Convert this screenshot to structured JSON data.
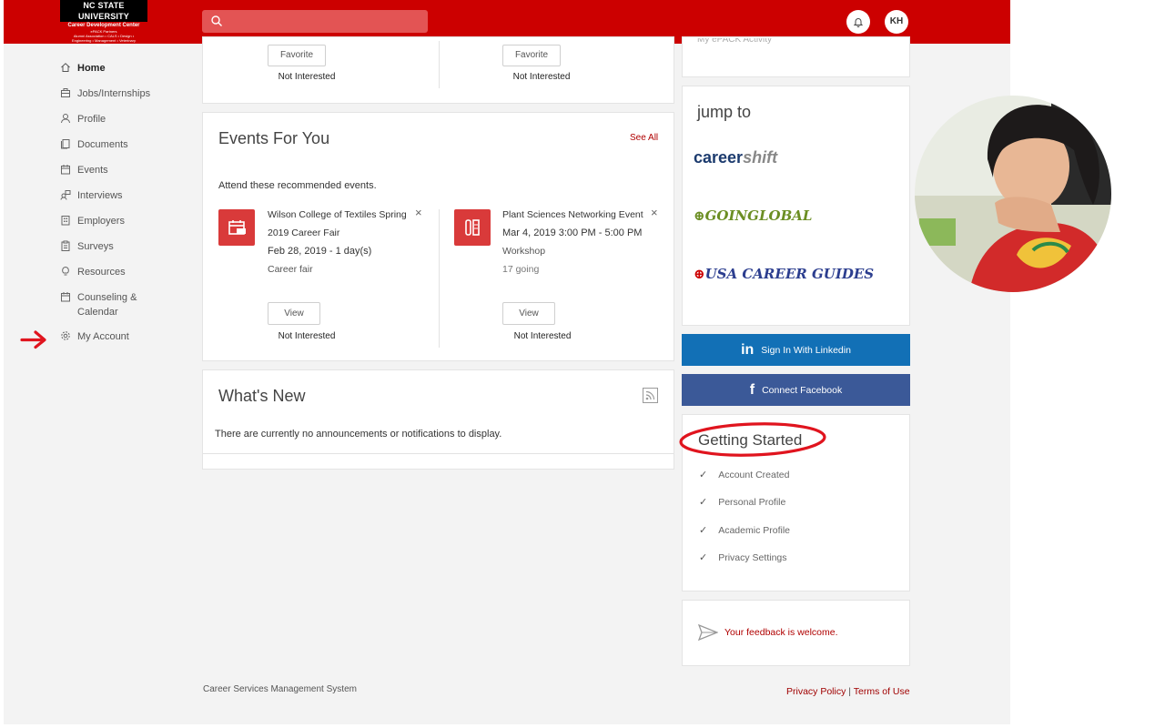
{
  "header": {
    "logo": {
      "line1": "NC STATE UNIVERSITY",
      "line2": "Career Development Center",
      "line3": "ePACK Partners",
      "line4": "Alumni Association • CALS • Design •",
      "line5": "Engineering • Management • Veterinary",
      "line6": "Medicine"
    },
    "search_placeholder": "",
    "avatar_initials": "KH"
  },
  "sidebar": {
    "items": [
      {
        "label": "Home",
        "icon": "home-icon",
        "active": true
      },
      {
        "label": "Jobs/Internships",
        "icon": "briefcase-icon"
      },
      {
        "label": "Profile",
        "icon": "person-icon"
      },
      {
        "label": "Documents",
        "icon": "documents-icon"
      },
      {
        "label": "Events",
        "icon": "calendar-icon"
      },
      {
        "label": "Interviews",
        "icon": "interviews-icon"
      },
      {
        "label": "Employers",
        "icon": "building-icon"
      },
      {
        "label": "Surveys",
        "icon": "clipboard-icon"
      },
      {
        "label": "Resources",
        "icon": "lightbulb-icon"
      },
      {
        "label": "Counseling &",
        "label2": "Calendar",
        "icon": "calendar-icon"
      },
      {
        "label": "My Account",
        "icon": "gear-icon"
      }
    ]
  },
  "top_card": {
    "left": {
      "favorite_label": "Favorite",
      "not_interested_label": "Not Interested"
    },
    "right": {
      "favorite_label": "Favorite",
      "not_interested_label": "Not Interested"
    }
  },
  "events": {
    "title": "Events For You",
    "see_all": "See All",
    "subtitle": "Attend these recommended events.",
    "items": [
      {
        "title_line1": "Wilson College of Textiles Spring",
        "title_line2": "2019 Career Fair",
        "date": "Feb 28, 2019 - 1 day(s)",
        "type": "Career fair",
        "going": "",
        "view_label": "View",
        "not_interested_label": "Not Interested"
      },
      {
        "title_line1": "Plant Sciences Networking Event",
        "title_line2": "",
        "date": "Mar 4, 2019 3:00 PM - 5:00 PM",
        "type": "Workshop",
        "going": "17 going",
        "view_label": "View",
        "not_interested_label": "Not Interested"
      }
    ]
  },
  "whats_new": {
    "title": "What's New",
    "message": "There are currently no announcements or notifications to display."
  },
  "right_top_card": {
    "partial_text": "My ePACK Activity"
  },
  "jump_to": {
    "title": "jump to",
    "links": [
      {
        "part1": "career",
        "part2": "shift"
      },
      {
        "label": "GOINGLOBAL"
      },
      {
        "label": "USA CAREER GUIDES"
      }
    ]
  },
  "social": {
    "linkedin_label": "Sign In With Linkedin",
    "facebook_label": "Connect Facebook"
  },
  "getting_started": {
    "title": "Getting Started",
    "items": [
      "Account Created",
      "Personal Profile",
      "Academic Profile",
      "Privacy Settings"
    ]
  },
  "feedback": {
    "label": "Your feedback is welcome."
  },
  "footer": {
    "system_name": "Career Services Management System",
    "privacy_policy": "Privacy Policy",
    "separator": "|",
    "terms": "Terms of Use"
  },
  "colors": {
    "brand_red": "#cc0000",
    "linkedin": "#1270b6",
    "facebook": "#3b5998",
    "link_red": "#b00000",
    "annotation_red": "#e0141e"
  }
}
